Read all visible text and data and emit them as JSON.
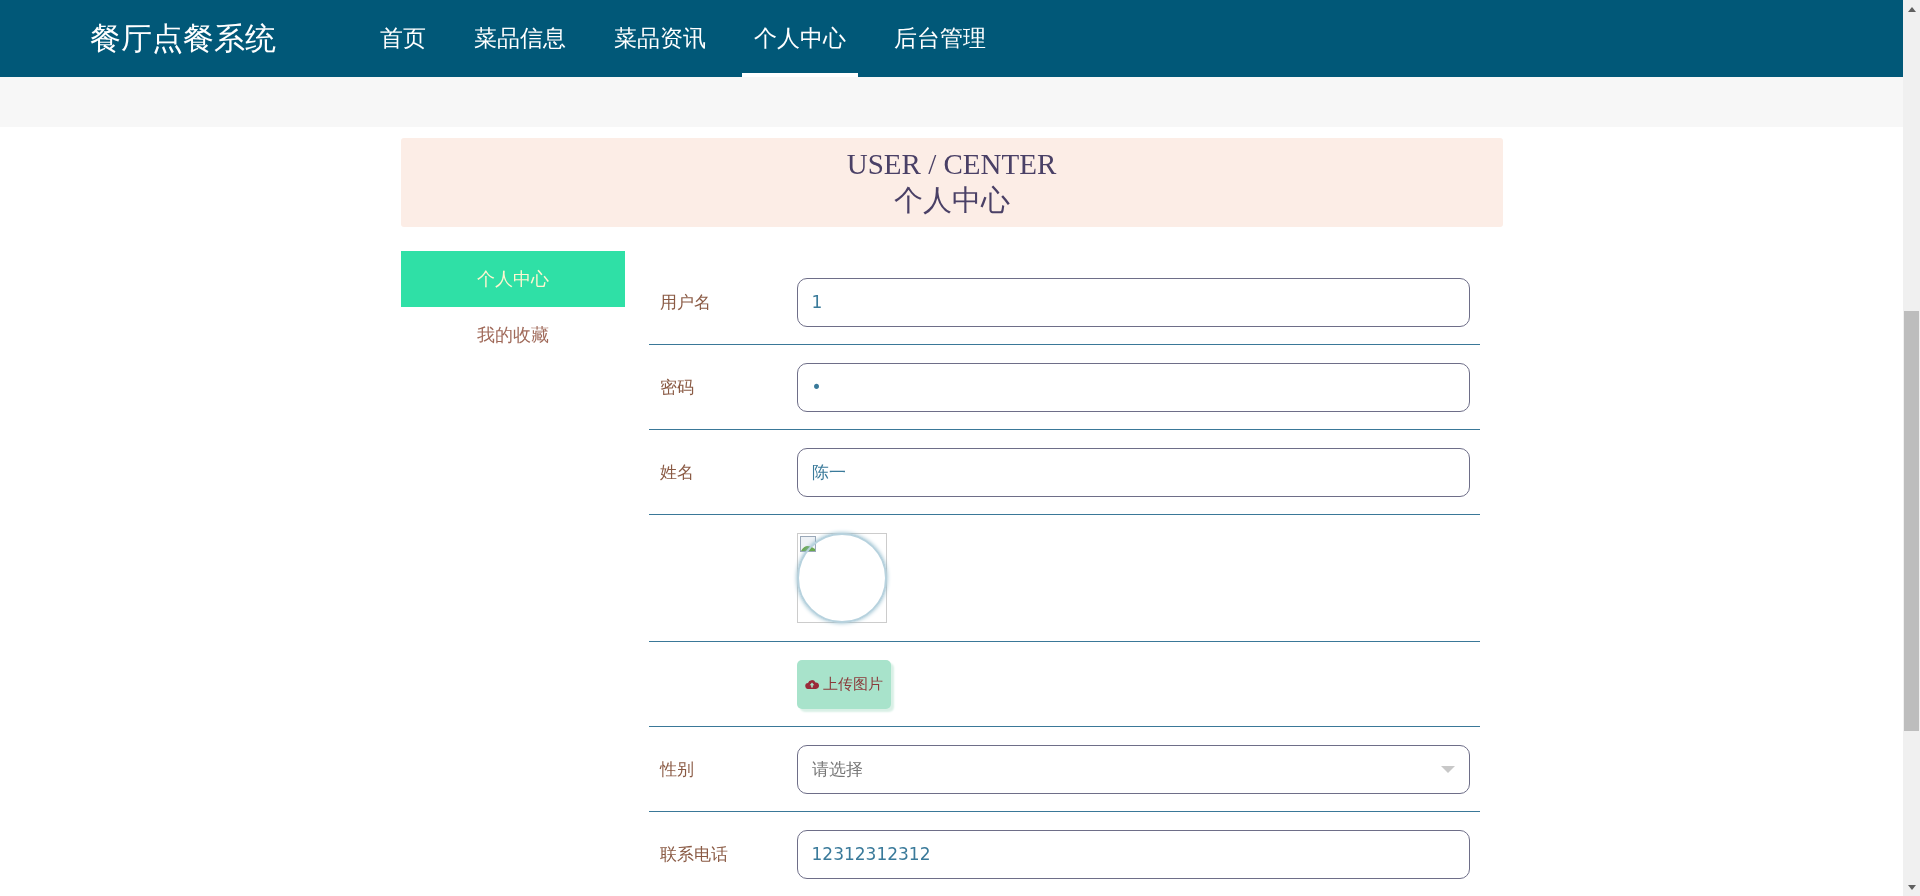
{
  "header": {
    "brand": "餐厅点餐系统",
    "nav": [
      {
        "label": "首页",
        "selected": false
      },
      {
        "label": "菜品信息",
        "selected": false
      },
      {
        "label": "菜品资讯",
        "selected": false
      },
      {
        "label": "个人中心",
        "selected": true
      },
      {
        "label": "后台管理",
        "selected": false
      }
    ]
  },
  "banner": {
    "title_en": "USER / CENTER",
    "title_zh": "个人中心"
  },
  "sidebar": {
    "items": [
      {
        "label": "个人中心",
        "selected": true
      },
      {
        "label": "我的收藏",
        "selected": false
      }
    ]
  },
  "form": {
    "rows": [
      {
        "kind": "input",
        "label": "用户名",
        "value": "1"
      },
      {
        "kind": "input",
        "label": "密码",
        "value": "•"
      },
      {
        "kind": "input",
        "label": "姓名",
        "value": "陈一"
      },
      {
        "kind": "avatar"
      },
      {
        "kind": "upload",
        "button": "上传图片"
      },
      {
        "kind": "select",
        "label": "性别",
        "placeholder": "请选择"
      },
      {
        "kind": "input",
        "label": "联系电话",
        "value": "12312312312"
      }
    ]
  }
}
